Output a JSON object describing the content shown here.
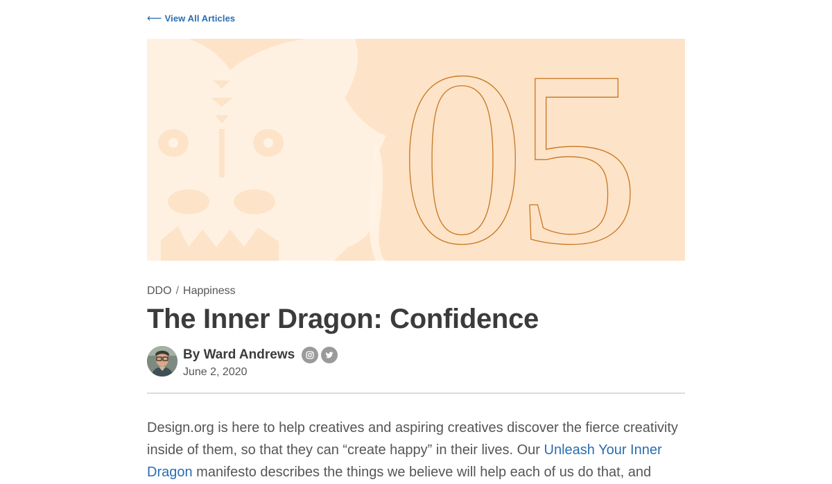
{
  "nav": {
    "back_arrow": "⟵",
    "back_label": "View All Articles"
  },
  "hero": {
    "number": "05",
    "bg_color": "#fde3c8",
    "accent_color": "#c7761f",
    "dragon_color": "#fff3e6"
  },
  "breadcrumb": {
    "items": [
      "DDO",
      "Happiness"
    ],
    "separator": "/"
  },
  "article": {
    "title": "The Inner Dragon: Confidence",
    "author": "By Ward Andrews",
    "date": "June 2, 2020",
    "social": [
      "instagram-icon",
      "twitter-icon"
    ],
    "intro_part1": "Design.org is here to help creatives and aspiring creatives discover the fierce creativity inside of them, so that they can “create happy” in their lives. Our ",
    "intro_link": "Unleash Your Inner Dragon",
    "intro_part2": " manifesto describes the things we believe will help each of us do that, and"
  },
  "colors": {
    "link": "#2a6db0",
    "heading": "#3b3b3b",
    "text": "#555555"
  }
}
